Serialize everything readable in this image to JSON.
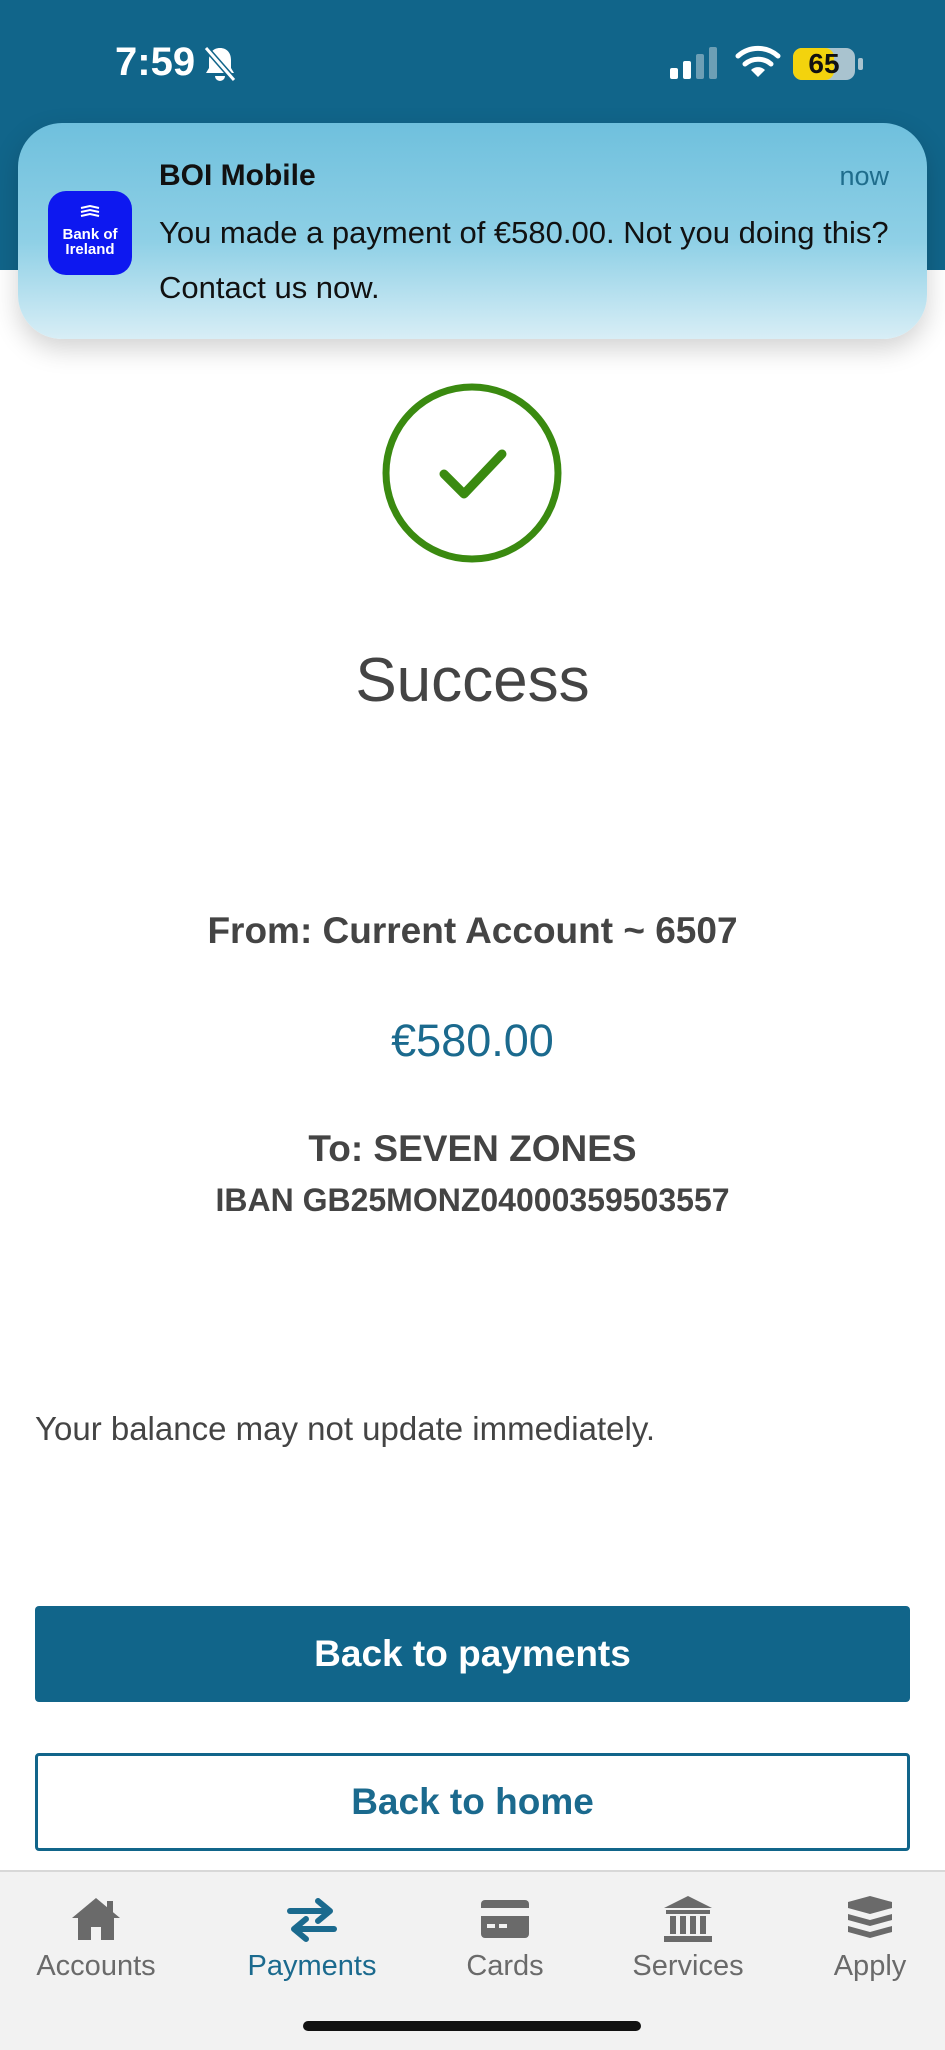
{
  "status_bar": {
    "time": "7:59",
    "battery": "65"
  },
  "notification": {
    "app_name": "BOI Mobile",
    "time": "now",
    "message": "You made a payment of €580.00.  Not you doing this? Contact us now.",
    "icon_text_line1": "Bank of",
    "icon_text_line2": "Ireland"
  },
  "result": {
    "title": "Success"
  },
  "payment": {
    "from": "From: Current Account ~ 6507",
    "amount": "€580.00",
    "to": "To: SEVEN ZONES",
    "iban": "IBAN GB25MONZ04000359503557"
  },
  "note": "Your balance may not update immediately.",
  "actions": {
    "back_to_payments": "Back to payments",
    "back_to_home": "Back to home"
  },
  "tabs": [
    {
      "label": "Accounts",
      "icon": "house-icon",
      "active": false
    },
    {
      "label": "Payments",
      "icon": "transfer-arrows-icon",
      "active": true
    },
    {
      "label": "Cards",
      "icon": "card-icon",
      "active": false
    },
    {
      "label": "Services",
      "icon": "bank-icon",
      "active": false
    },
    {
      "label": "Apply",
      "icon": "layers-icon",
      "active": false
    }
  ],
  "colors": {
    "brand": "#11658a",
    "success": "#3a8a10",
    "boi_blue": "#0d18f0"
  }
}
